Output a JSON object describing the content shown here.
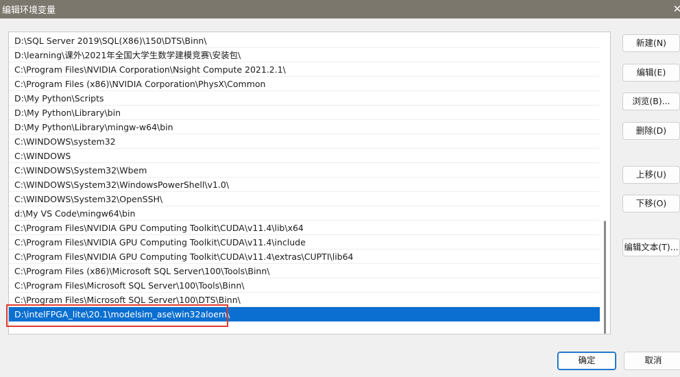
{
  "window": {
    "title": "编辑环境变量",
    "close_glyph": "✕"
  },
  "path_list": {
    "items": [
      "D:\\SQL Server 2019\\SQL(X86)\\150\\DTS\\Binn\\",
      "D:\\learning\\课外\\2021年全国大学生数学建模竞赛\\安装包\\",
      "C:\\Program Files\\NVIDIA Corporation\\Nsight Compute 2021.2.1\\",
      "C:\\Program Files (x86)\\NVIDIA Corporation\\PhysX\\Common",
      "D:\\My Python\\Scripts",
      "D:\\My Python\\Library\\bin",
      "D:\\My Python\\Library\\mingw-w64\\bin",
      "C:\\WINDOWS\\system32",
      "C:\\WINDOWS",
      "C:\\WINDOWS\\System32\\Wbem",
      "C:\\WINDOWS\\System32\\WindowsPowerShell\\v1.0\\",
      "C:\\WINDOWS\\System32\\OpenSSH\\",
      "d:\\My VS Code\\mingw64\\bin",
      "C:\\Program Files\\NVIDIA GPU Computing Toolkit\\CUDA\\v11.4\\lib\\x64",
      "C:\\Program Files\\NVIDIA GPU Computing Toolkit\\CUDA\\v11.4\\include",
      "C:\\Program Files\\NVIDIA GPU Computing Toolkit\\CUDA\\v11.4\\extras\\CUPTI\\lib64",
      "C:\\Program Files (x86)\\Microsoft SQL Server\\100\\Tools\\Binn\\",
      "C:\\Program Files\\Microsoft SQL Server\\100\\Tools\\Binn\\",
      "C:\\Program Files\\Microsoft SQL Server\\100\\DTS\\Binn\\",
      "D:\\intelFPGA_lite\\20.1\\modelsim_ase\\win32aloem\\"
    ],
    "selected_index": 19,
    "selected_color": "#0a6fd0",
    "highlight_color": "#e0392e"
  },
  "buttons": {
    "new": "新建(N)",
    "edit": "编辑(E)",
    "browse": "浏览(B)...",
    "delete": "删除(D)",
    "move_up": "上移(U)",
    "move_down": "下移(O)",
    "edit_text": "编辑文本(T)...",
    "ok": "确定",
    "cancel": "取消"
  }
}
